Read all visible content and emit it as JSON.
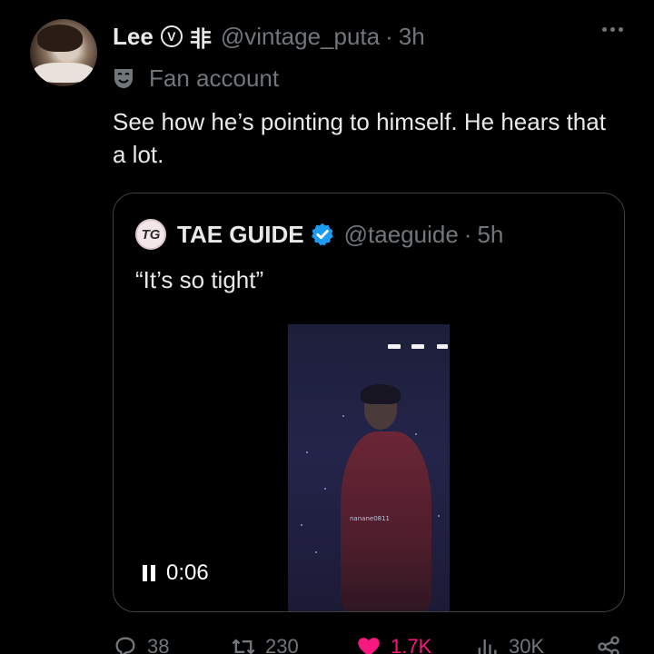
{
  "tweet": {
    "author_name": "Lee",
    "badge_letter": "V",
    "name_glyph": "非",
    "handle": "@vintage_puta",
    "separator": "·",
    "time": "3h",
    "label": "Fan account",
    "text": "See how he’s pointing to himself. He hears that a lot."
  },
  "quote": {
    "avatar_text": "TG",
    "author_name": "TAE GUIDE",
    "handle": "@taeguide",
    "separator": "·",
    "time": "5h",
    "text": "“It’s so tight”",
    "video": {
      "watermark": "nanane0811",
      "elapsed": "0:06",
      "state": "playing"
    }
  },
  "actions": {
    "replies": "38",
    "retweets": "230",
    "likes": "1.7K",
    "views": "30K"
  },
  "colors": {
    "background": "#000000",
    "text_primary": "#e7e9ea",
    "text_secondary": "#71767b",
    "verified_blue": "#1d9bf0",
    "like_pink": "#f91880"
  }
}
